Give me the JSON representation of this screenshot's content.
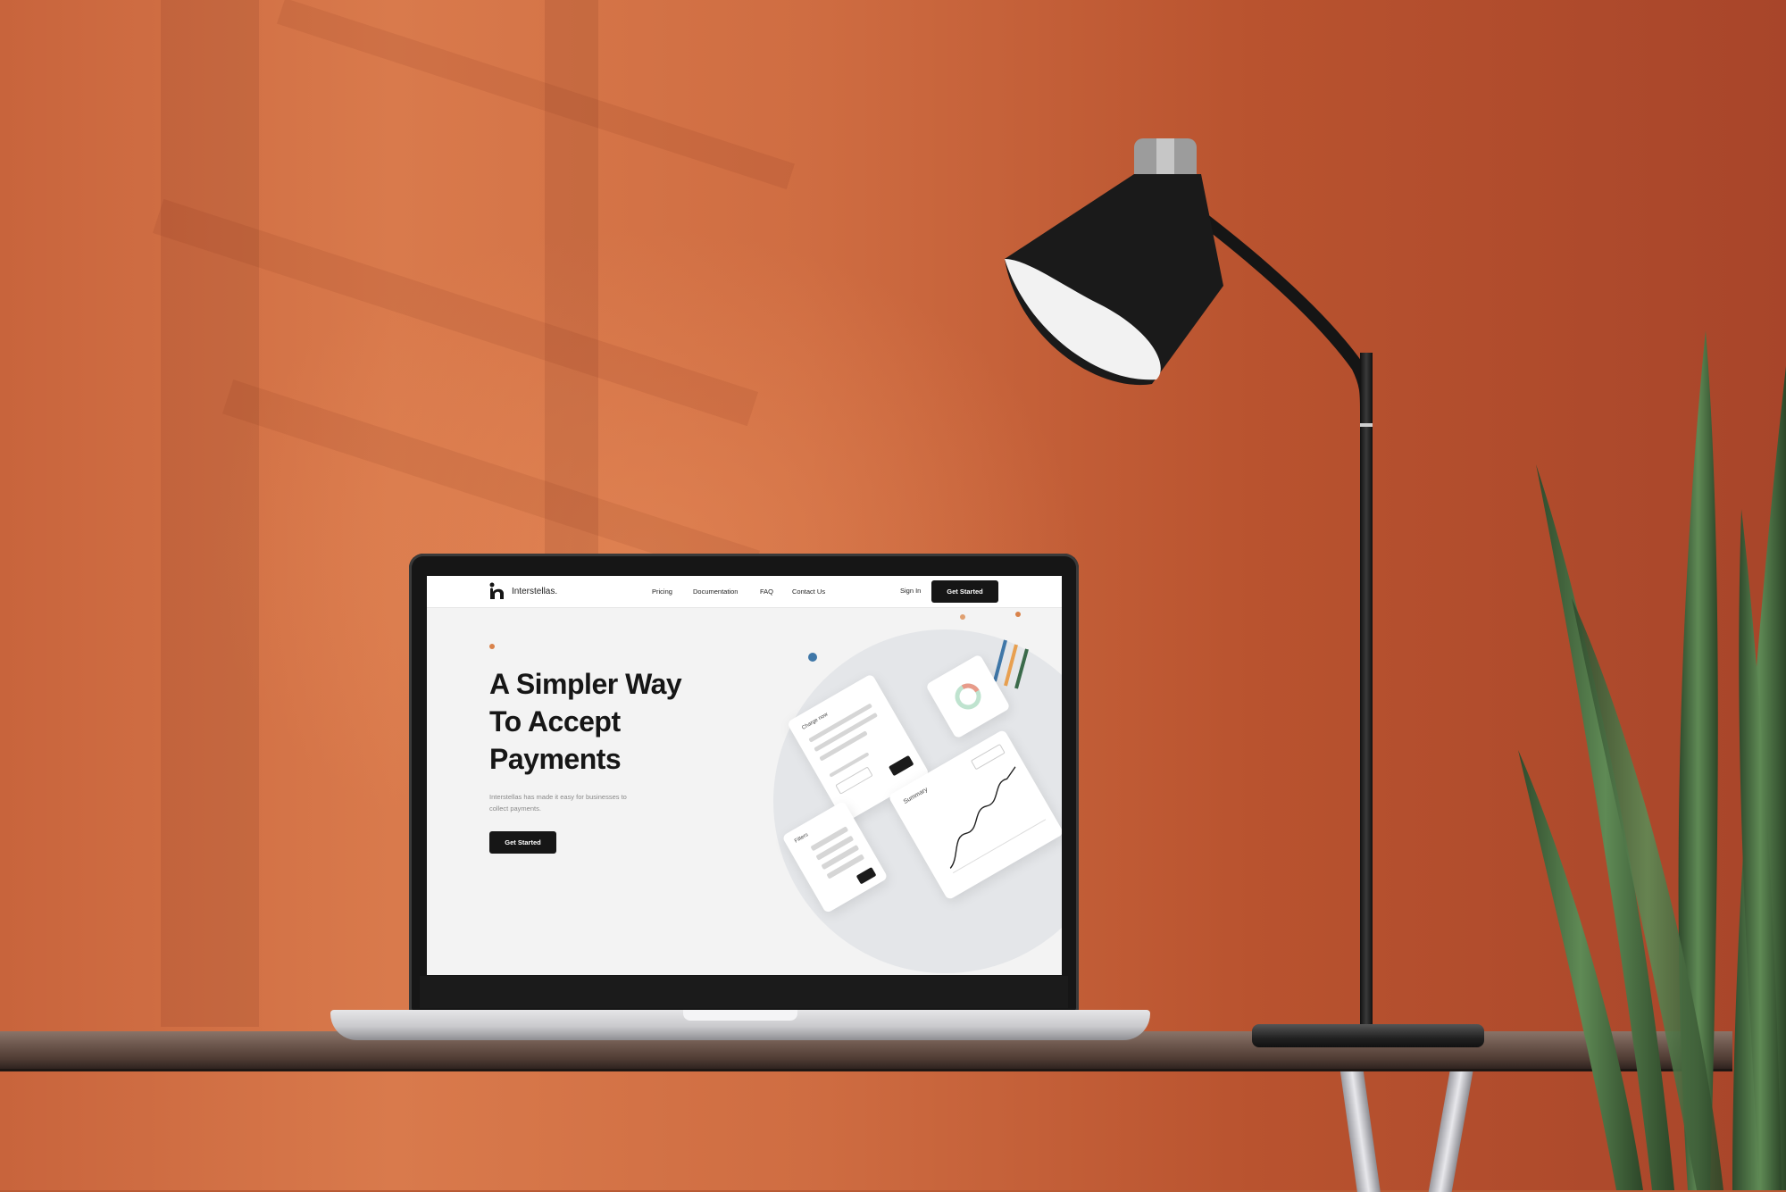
{
  "brand": {
    "name": "Interstellas."
  },
  "nav": {
    "links": [
      "Pricing",
      "Documentation",
      "FAQ",
      "Contact Us"
    ],
    "sign_in": "Sign In",
    "cta": "Get Started"
  },
  "hero": {
    "title_line1": "A Simpler Way",
    "title_line2": "To Accept",
    "title_line3": "Payments",
    "subtitle": "Interstellas has made it easy for businesses to collect payments.",
    "cta": "Get Started"
  },
  "illustration": {
    "cards": {
      "charge": "Charge now",
      "filters": "Filters",
      "summary": "Summary"
    }
  },
  "colors": {
    "accent_orange": "#d9824a",
    "accent_blue": "#3f77a8",
    "accent_green": "#3a6a4a",
    "button_dark": "#161616",
    "wall": "#c8643c"
  }
}
